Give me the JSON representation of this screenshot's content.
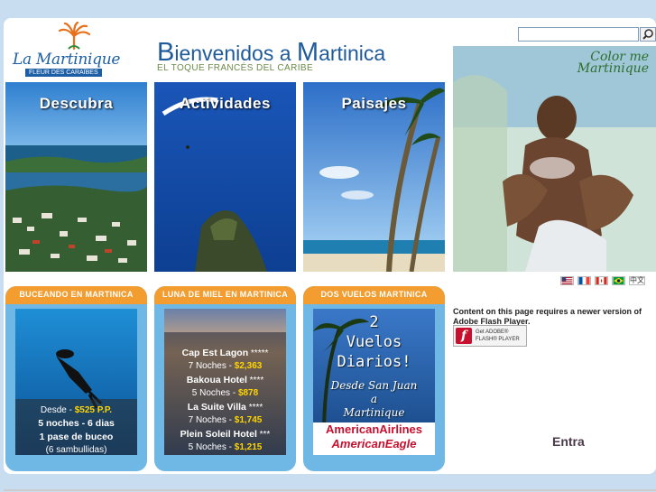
{
  "header": {
    "logo_name": "La Martinique",
    "logo_tagline": "FLEUR DES CARAÏBES",
    "welcome_prefix": "B",
    "welcome_mid": "ienvenidos a ",
    "welcome_m": "M",
    "welcome_rest": "artinica",
    "subtitle": "EL TOQUE FRANCÉS DEL CARIBE"
  },
  "search": {
    "placeholder": "",
    "value": "",
    "icon": "search-icon"
  },
  "panels": [
    {
      "label": "Descubra"
    },
    {
      "label": "Actividades"
    },
    {
      "label": "Paisajes"
    }
  ],
  "photo": {
    "script_line1": "Color me",
    "script_line2": "Martinique"
  },
  "flags": [
    "us-flag",
    "france-flag",
    "canada-flag",
    "brazil-flag",
    "中文"
  ],
  "promos": [
    {
      "title": "BUCEANDO EN MARTINICA",
      "line1_prefix": "Desde - ",
      "line1_price": "$525 P.P.",
      "line2": "5 noches - 6 dias",
      "line3": "1 pase de buceo",
      "line4": "(6 sambullidas)"
    },
    {
      "title": "LUNA DE MIEL EN MARTINICA",
      "hotels": [
        {
          "name": "Cap Est Lagon",
          "stars": "*****",
          "nights": "7 Noches - ",
          "price": "$2,363"
        },
        {
          "name": "Bakoua Hotel",
          "stars": "****",
          "nights": "5 Noches - ",
          "price": "$878"
        },
        {
          "name": "La Suite Villa",
          "stars": "****",
          "nights": "7 Noches - ",
          "price": "$1,745"
        },
        {
          "name": "Plein Soleil Hotel",
          "stars": "***",
          "nights": "5 Noches - ",
          "price": "$1,215"
        }
      ]
    },
    {
      "title": "DOS VUELOS MARTINICA",
      "big1": "2",
      "big2": "Vuelos",
      "big3": "Diarios!",
      "from": "Desde San Juan",
      "a": "a",
      "dest": "Martinique",
      "airline1": "AmericanAirlines",
      "airline2": "AmericanEagle"
    }
  ],
  "flash": {
    "message": "Content on this page requires a newer version of Adobe Flash Player.",
    "badge_line1": "Get ADOBE®",
    "badge_line2": "FLASH® PLAYER"
  },
  "entra": "Entra",
  "colors": {
    "accent": "#f39c2f",
    "brand_blue": "#1d5fa6",
    "promo_bg": "#6fb8e6"
  }
}
